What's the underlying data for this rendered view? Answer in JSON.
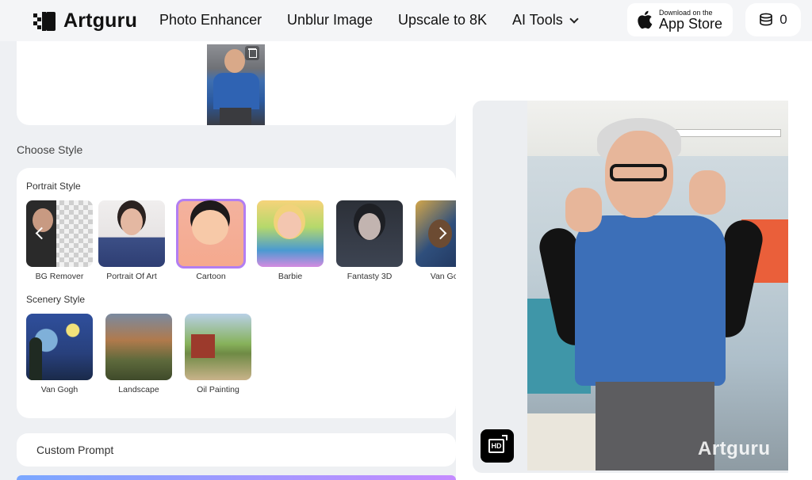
{
  "header": {
    "logo_text": "Artguru",
    "nav": [
      "Photo Enhancer",
      "Unblur Image",
      "Upscale to 8K",
      "AI Tools"
    ],
    "appstore_small": "Download on the",
    "appstore_big": "App Store",
    "coins": "0"
  },
  "styles": {
    "section_title": "Choose Style",
    "portrait_title": "Portrait Style",
    "portrait": [
      {
        "label": "BG Remover",
        "selected": false
      },
      {
        "label": "Portrait Of Art",
        "selected": false
      },
      {
        "label": "Cartoon",
        "selected": true
      },
      {
        "label": "Barbie",
        "selected": false
      },
      {
        "label": "Fantasty 3D",
        "selected": false
      },
      {
        "label": "Van Gogh",
        "selected": false
      }
    ],
    "scenery_title": "Scenery Style",
    "scenery": [
      {
        "label": "Van Gogh"
      },
      {
        "label": "Landscape"
      },
      {
        "label": "Oil Painting"
      }
    ]
  },
  "prompt": {
    "label": "Custom Prompt"
  },
  "result": {
    "watermark": "Artguru",
    "hd_label": "HD"
  },
  "colors": {
    "accent": "#b27ef2",
    "background": "#eef0f3",
    "card": "#ffffff"
  }
}
